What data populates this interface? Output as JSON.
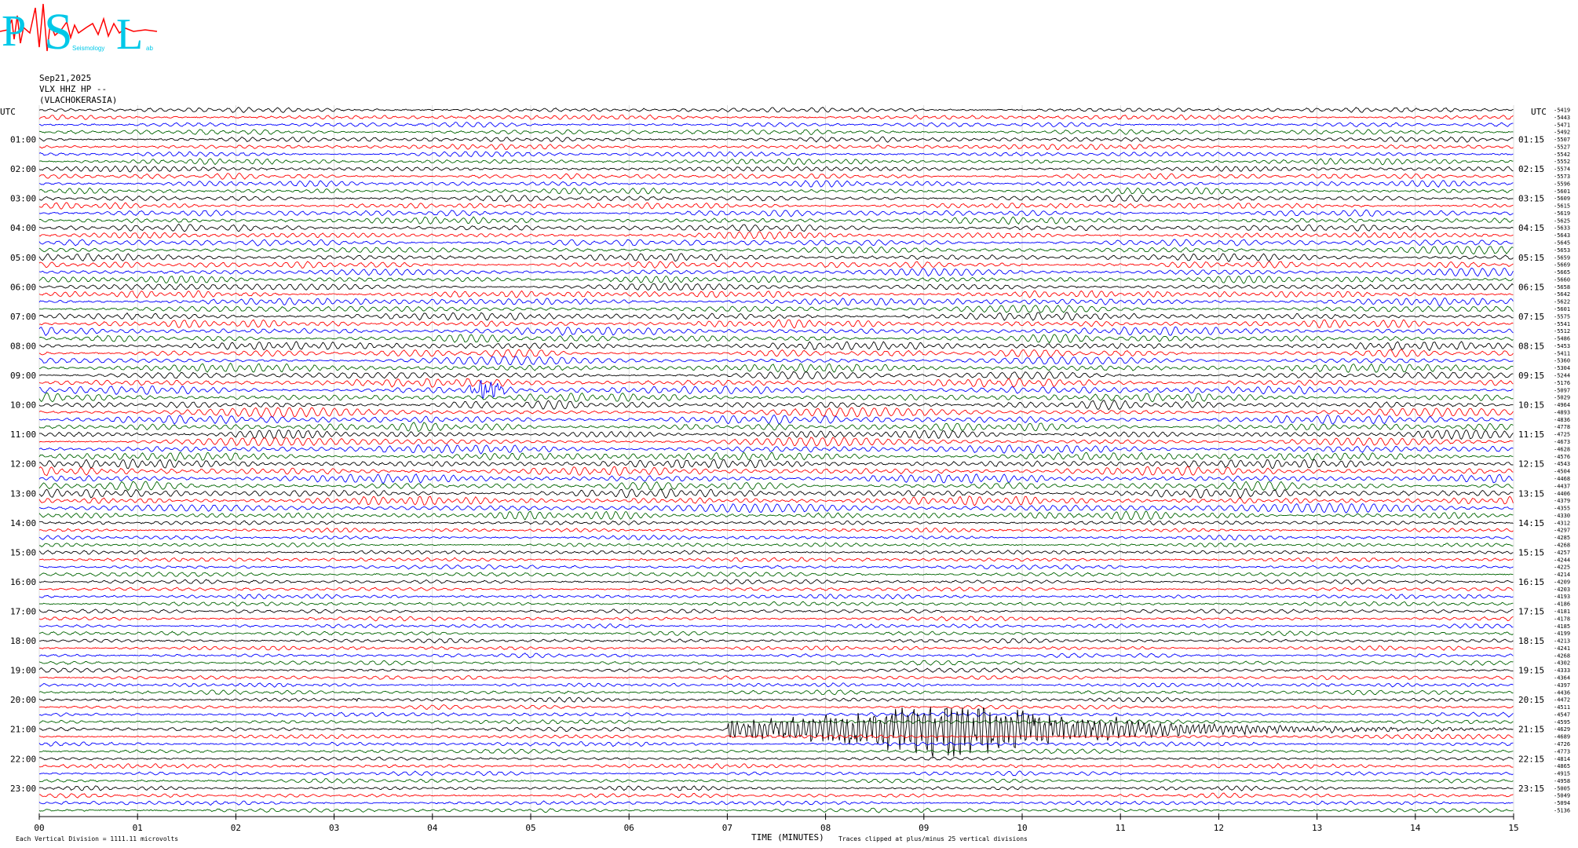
{
  "logo": {
    "letters": [
      "P",
      "S",
      "L"
    ],
    "subtext": "Seismology",
    "subtext_lab": "ab",
    "colors": {
      "letters": "#00c8e8",
      "wave": "#ff0000"
    }
  },
  "header": {
    "date": "Sep21,2025",
    "station": "VLX HHZ HP --",
    "location": "(VLACHOKERASIA)"
  },
  "chart_data": {
    "type": "helicorder",
    "colors": [
      "#000000",
      "#ff0000",
      "#0000ff",
      "#006400"
    ],
    "left_axis_title": "UTC",
    "right_axis_title": "UTC",
    "left_labels": [
      "01:00",
      "02:00",
      "03:00",
      "04:00",
      "05:00",
      "06:00",
      "07:00",
      "08:00",
      "09:00",
      "10:00",
      "11:00",
      "12:00",
      "13:00",
      "14:00",
      "15:00",
      "16:00",
      "17:00",
      "18:00",
      "19:00",
      "20:00",
      "21:00",
      "22:00",
      "23:00"
    ],
    "right_labels": [
      "01:15",
      "02:15",
      "03:15",
      "04:15",
      "05:15",
      "06:15",
      "07:15",
      "08:15",
      "09:15",
      "10:15",
      "11:15",
      "12:15",
      "13:15",
      "14:15",
      "15:15",
      "16:15",
      "17:15",
      "18:15",
      "19:15",
      "20:15",
      "21:15",
      "22:15",
      "23:15"
    ],
    "offsets": [
      "-5419",
      "-5443",
      "-5471",
      "-5492",
      "-5507",
      "-5527",
      "-5542",
      "-5552",
      "-5574",
      "-5573",
      "-5596",
      "-5601",
      "-5609",
      "-5615",
      "-5619",
      "-5625",
      "-5633",
      "-5643",
      "-5645",
      "-5653",
      "-5659",
      "-5669",
      "-5665",
      "-5660",
      "-5658",
      "-5642",
      "-5622",
      "-5601",
      "-5575",
      "-5541",
      "-5512",
      "-5486",
      "-5453",
      "-5411",
      "-5360",
      "-5304",
      "-5244",
      "-5176",
      "-5097",
      "-5029",
      "-4964",
      "-4893",
      "-4836",
      "-4778",
      "-4725",
      "-4673",
      "-4628",
      "-4576",
      "-4543",
      "-4504",
      "-4468",
      "-4437",
      "-4406",
      "-4379",
      "-4355",
      "-4330",
      "-4312",
      "-4297",
      "-4285",
      "-4268",
      "-4257",
      "-4244",
      "-4225",
      "-4214",
      "-4209",
      "-4203",
      "-4193",
      "-4186",
      "-4181",
      "-4178",
      "-4185",
      "-4199",
      "-4213",
      "-4241",
      "-4268",
      "-4302",
      "-4333",
      "-4364",
      "-4397",
      "-4436",
      "-4472",
      "-4511",
      "-4547",
      "-4595",
      "-4629",
      "-4689",
      "-4726",
      "-4773",
      "-4814",
      "-4865",
      "-4915",
      "-4958",
      "-5005",
      "-5049",
      "-5094",
      "-5136"
    ],
    "x_ticks": [
      "00",
      "01",
      "02",
      "03",
      "04",
      "05",
      "06",
      "07",
      "08",
      "09",
      "10",
      "11",
      "12",
      "13",
      "14",
      "15"
    ],
    "xlabel": "TIME (MINUTES)",
    "x_range": [
      0,
      15
    ],
    "rows": 96,
    "minutes_per_row": 15,
    "events": [
      {
        "row": 38,
        "start_min": 4.35,
        "end_min": 4.75,
        "amp": 3.0
      },
      {
        "row": 92,
        "start_min": 6.35,
        "end_min": 6.75,
        "amp": 0.4
      },
      {
        "row": 80,
        "start_min": 3.1,
        "end_min": 3.3,
        "amp": 0.6
      },
      {
        "row": 84,
        "start_min": 7.0,
        "end_min": 15.0,
        "amp": 9.0
      }
    ],
    "footer_left": "Each Vertical Division = 1111.11 microvolts",
    "footer_right": "Traces clipped at plus/minus 25 vertical divisions"
  }
}
